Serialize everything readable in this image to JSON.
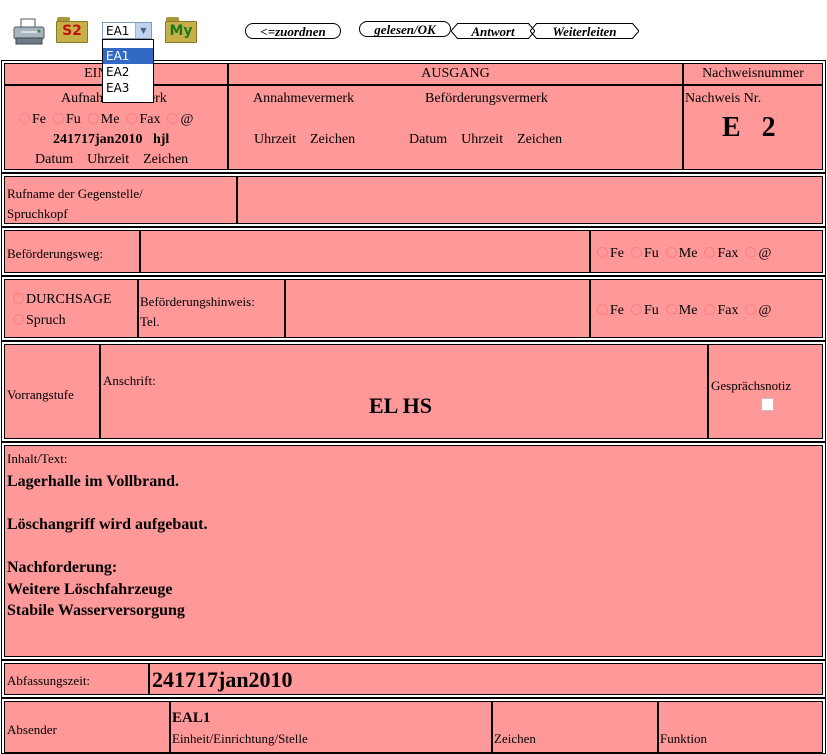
{
  "toolbar": {
    "printer_icon": "printer-icon",
    "folder_s2_label": "S2",
    "folder_my_label": "My",
    "select_value": "EA1",
    "select_options": [
      "EA1",
      "EA2",
      "EA3"
    ],
    "btn_zuordnen": "<=zuordnen",
    "btn_gelesen": "gelesen/OK",
    "btn_antwort": "Antwort",
    "btn_weiterleiten": "Weiterleiten"
  },
  "header": {
    "eingang": "EINGANG",
    "ausgang": "AUSGANG",
    "nachweisnummer": "Nachweisnummer",
    "aufnahmevermerk": "Aufnahmevermerk",
    "annahmevermerk": "Annahmevermerk",
    "befoerderungsvermerk": "Beförderungsvermerk",
    "nachweis_nr_label": "Nachweis Nr.",
    "nachweis_nr_value": "E   2",
    "radios": [
      "Fe",
      "Fu",
      "Me",
      "Fax",
      "@"
    ],
    "aufnahme_dtg": "241717jan2010",
    "aufnahme_zeichen": "hjl",
    "datum": "Datum",
    "uhrzeit": "Uhrzeit",
    "zeichen": "Zeichen"
  },
  "rufname": {
    "label_line1": "Rufname der Gegenstelle/",
    "label_line2": "Spruchkopf"
  },
  "befoerderungsweg": {
    "label": "Beförderungsweg:"
  },
  "durchsage": {
    "opt1": "DURCHSAGE",
    "opt2": "Spruch",
    "hinweis_label": "Beförderungshinweis:",
    "tel_label": "Tel."
  },
  "vorrang": {
    "label": "Vorrangstufe",
    "anschrift_label": "Anschrift:",
    "anschrift_value": "EL HS",
    "gespraechsnotiz": "Gesprächsnotiz"
  },
  "inhalt": {
    "label": "Inhalt/Text:",
    "lines": [
      "Lagerhalle im Vollbrand.",
      "",
      "Löschangriff wird aufgebaut.",
      "",
      "Nachforderung:",
      "Weitere Löschfahrzeuge",
      "Stabile Wasserversorgung"
    ]
  },
  "abfassung": {
    "label": "Abfassungszeit:",
    "value": "241717jan2010"
  },
  "absender": {
    "label": "Absender",
    "value": "EAL1",
    "einheit_label": "Einheit/Einrichtung/Stelle",
    "zeichen_label": "Zeichen",
    "funktion_label": "Funktion"
  }
}
